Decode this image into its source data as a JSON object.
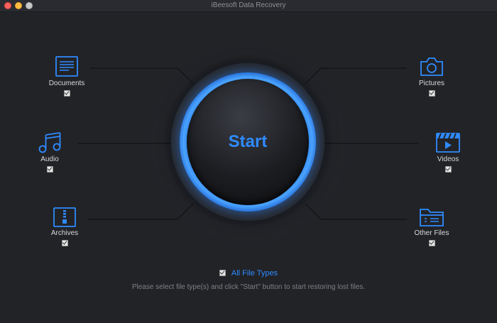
{
  "window": {
    "title": "iBeesoft Data Recovery"
  },
  "start_button": {
    "label": "Start"
  },
  "categories": {
    "documents": {
      "label": "Documents",
      "checked": true,
      "icon": "document-icon"
    },
    "audio": {
      "label": "Audio",
      "checked": true,
      "icon": "music-note-icon"
    },
    "archives": {
      "label": "Archives",
      "checked": true,
      "icon": "archive-icon"
    },
    "pictures": {
      "label": "Pictures",
      "checked": true,
      "icon": "camera-icon"
    },
    "videos": {
      "label": "Videos",
      "checked": true,
      "icon": "video-clapper-icon"
    },
    "other_files": {
      "label": "Other Files",
      "checked": true,
      "icon": "folder-icon"
    }
  },
  "all_file_types": {
    "label": "All File Types",
    "checked": true
  },
  "instruction": "Please select file type(s) and click \"Start\" button to start restoring lost files.",
  "colors": {
    "accent": "#2f8bff",
    "background": "#222327",
    "ring": "#1d6de0"
  }
}
